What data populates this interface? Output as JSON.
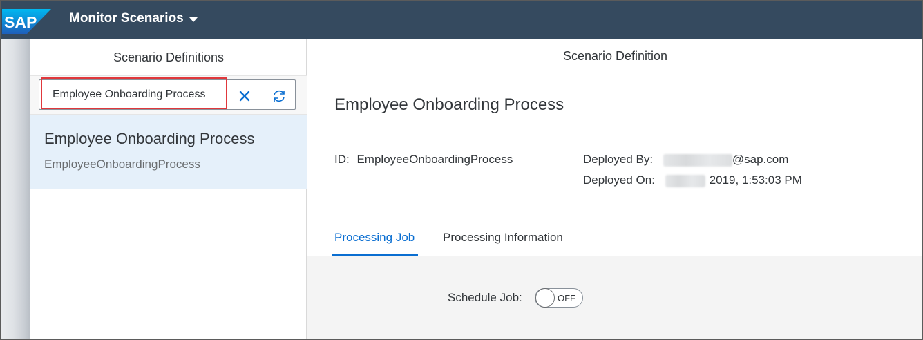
{
  "shell": {
    "title": "Monitor Scenarios",
    "logo_text": "SAP",
    "brand_color": "#0a6ed1"
  },
  "master": {
    "header": "Scenario Definitions",
    "search": {
      "value": "Employee Onboarding Process",
      "placeholder": ""
    },
    "items": [
      {
        "title": "Employee Onboarding Process",
        "subtitle": "EmployeeOnboardingProcess"
      }
    ]
  },
  "detail": {
    "header": "Scenario Definition",
    "title": "Employee Onboarding Process",
    "id_label": "ID:",
    "id_value": "EmployeeOnboardingProcess",
    "deployed_by_label": "Deployed By:",
    "deployed_by_value": "@sap.com",
    "deployed_on_label": "Deployed On:",
    "deployed_on_value": "2019, 1:53:03 PM",
    "tabs": [
      {
        "label": "Processing Job",
        "active": true
      },
      {
        "label": "Processing Information",
        "active": false
      }
    ],
    "schedule_label": "Schedule Job:",
    "toggle_text": "OFF"
  }
}
